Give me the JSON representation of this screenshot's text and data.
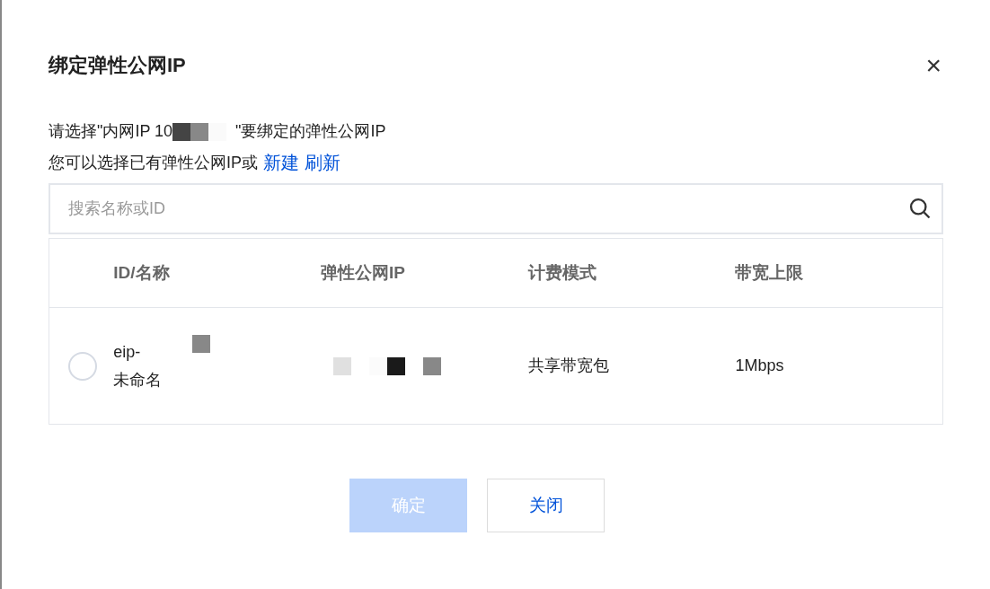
{
  "dialog": {
    "title": "绑定弹性公网IP",
    "close": "×"
  },
  "prompt": {
    "before": "请选择\"内网IP 10",
    "after": "\"要绑定的弹性公网IP"
  },
  "hint": {
    "text": "您可以选择已有弹性公网IP或",
    "links": [
      "新建",
      "刷新"
    ]
  },
  "search": {
    "placeholder": "搜索名称或ID"
  },
  "table": {
    "columns": [
      "ID/名称",
      "弹性公网IP",
      "计费模式",
      "带宽上限"
    ],
    "rows": [
      {
        "selected": false,
        "id": "eip-",
        "name": "未命名",
        "billing": "共享带宽包",
        "bandwidth": "1Mbps"
      }
    ]
  },
  "buttons": [
    {
      "label": "确定",
      "kind": "primary",
      "disabled": true
    },
    {
      "label": "关闭",
      "kind": "secondary",
      "disabled": false
    }
  ]
}
